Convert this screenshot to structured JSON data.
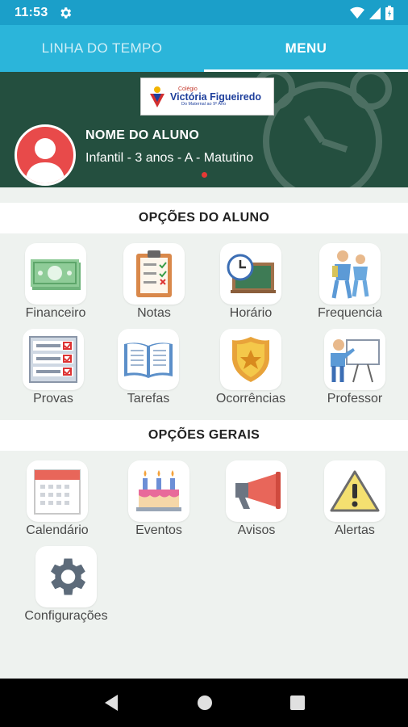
{
  "status": {
    "time": "11:53"
  },
  "tabs": [
    {
      "label": "LINHA DO TEMPO"
    },
    {
      "label": "MENU"
    }
  ],
  "header": {
    "logo_small": "Colégio",
    "logo_name": "Victória Figueiredo",
    "logo_tag": "Do Maternal ao 9º Ano",
    "student_name": "NOME DO ALUNO",
    "student_class": "Infantil - 3 anos - A - Matutino"
  },
  "student_options": {
    "title": "OPÇÕES DO ALUNO",
    "items": [
      {
        "label": "Financeiro",
        "icon": "money-icon"
      },
      {
        "label": "Notas",
        "icon": "clipboard-icon"
      },
      {
        "label": "Horário",
        "icon": "clock-board-icon"
      },
      {
        "label": "Frequencia",
        "icon": "students-icon"
      },
      {
        "label": "Provas",
        "icon": "exam-icon"
      },
      {
        "label": "Tarefas",
        "icon": "book-icon"
      },
      {
        "label": "Ocorrências",
        "icon": "badge-icon"
      },
      {
        "label": "Professor",
        "icon": "teacher-icon"
      }
    ]
  },
  "general_options": {
    "title": "OPÇÕES GERAIS",
    "items": [
      {
        "label": "Calendário",
        "icon": "calendar-icon"
      },
      {
        "label": "Eventos",
        "icon": "cake-icon"
      },
      {
        "label": "Avisos",
        "icon": "megaphone-icon"
      },
      {
        "label": "Alertas",
        "icon": "warning-icon"
      },
      {
        "label": "Configurações",
        "icon": "gear-icon"
      }
    ]
  }
}
